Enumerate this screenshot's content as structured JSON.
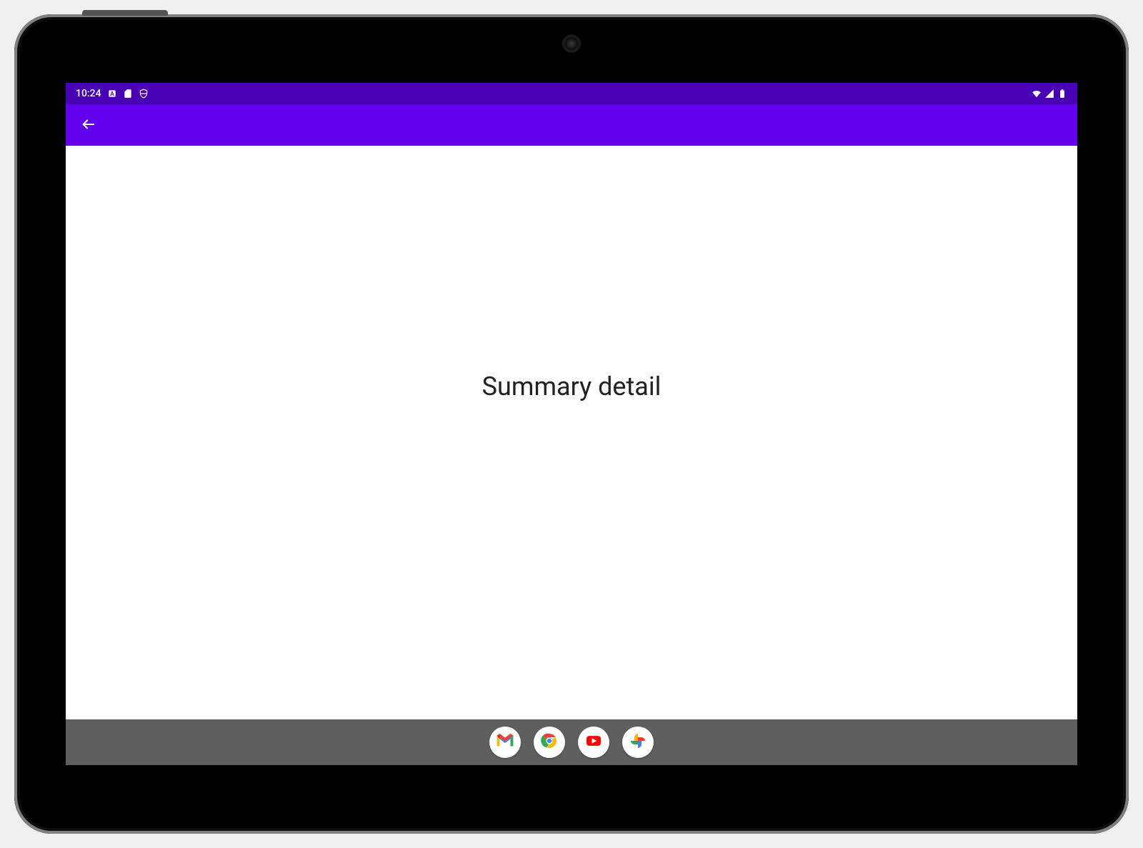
{
  "status_bar": {
    "time": "10:24",
    "left_icons": [
      "auto-rotate-icon",
      "sd-card-icon",
      "shield-icon"
    ],
    "right_icons": [
      "wifi-icon",
      "cell-signal-icon",
      "battery-icon"
    ]
  },
  "app_bar": {
    "back": "back-arrow-icon"
  },
  "content": {
    "title": "Summary detail"
  },
  "taskbar": {
    "apps": [
      "gmail",
      "chrome",
      "youtube",
      "photos"
    ]
  },
  "colors": {
    "primary": "#6200EE",
    "primary_dark": "#4700B3",
    "taskbar": "#5f5f5f"
  }
}
